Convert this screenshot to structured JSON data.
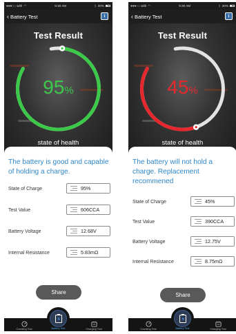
{
  "screens": [
    {
      "status": {
        "carrier": "●●●○○ with",
        "wifi": "wifi-icon",
        "time": "9:30 AM",
        "bluetooth": "bluetooth-icon",
        "battery": "30%"
      },
      "nav": {
        "back_label": "Battery Test",
        "info_icon": "info-icon"
      },
      "result": {
        "title": "Test Result",
        "value": "95",
        "unit": "%",
        "health_fraction": 0.95,
        "caption": "state of health",
        "color": "#3cc94a"
      },
      "message": "The battery is good and capable of holding a charge.",
      "rows": [
        {
          "label": "State of Charge",
          "value": "95%"
        },
        {
          "label": "Test Value",
          "value": "606CCA"
        },
        {
          "label": "Battery Voltage",
          "value": "12.68V"
        },
        {
          "label": "Internal Resistance",
          "value": "5.83mΩ"
        }
      ],
      "share_label": "Share",
      "tabs": {
        "cranking": "Cranking Test",
        "battery": "Battery Test",
        "charging": "Charging Test"
      }
    },
    {
      "status": {
        "carrier": "●●●○○ with",
        "wifi": "wifi-icon",
        "time": "9:30 AM",
        "bluetooth": "bluetooth-icon",
        "battery": "30%"
      },
      "nav": {
        "back_label": "Battery Test",
        "info_icon": "info-icon"
      },
      "result": {
        "title": "Test Result",
        "value": "45",
        "unit": "%",
        "health_fraction": 0.45,
        "caption": "state of health",
        "color": "#e5282e"
      },
      "message": "The battery will not hold a charge. Replacement recommened",
      "rows": [
        {
          "label": "State of Charge",
          "value": "45%"
        },
        {
          "label": "Test Value",
          "value": "390CCA"
        },
        {
          "label": "Battery Voltage",
          "value": "12.75V"
        },
        {
          "label": "Internal Resistance",
          "value": "8.75mΩ"
        }
      ],
      "share_label": "Share",
      "tabs": {
        "cranking": "Cranking Test",
        "battery": "Battery Test",
        "charging": "Charging Test"
      }
    }
  ]
}
